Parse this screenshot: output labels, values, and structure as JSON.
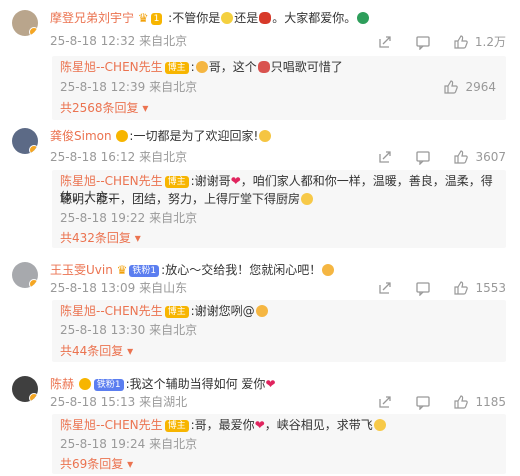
{
  "comments": [
    {
      "user": "摩登兄弟刘宇宁",
      "badge": "1",
      "text_a": ":不管你是",
      "text_b": "还是",
      "text_c": "。大家都爱你。",
      "time": "25-8-18 12:32",
      "loc": "来自北京",
      "likes": "1.2万",
      "reply": {
        "user": "陈星旭--CHEN先生",
        "badge": "博主",
        "text_a": ":",
        "text_b": "哥，这个",
        "text_c": "只唱歌可惜了",
        "time": "25-8-18 12:39",
        "loc": "来自北京",
        "likes": "2964"
      },
      "more": "共2568条回复"
    },
    {
      "user": "龚俊Simon",
      "text": ":一切都是为了欢迎回家!",
      "time": "25-8-18 16:12",
      "loc": "来自北京",
      "likes": "3607",
      "reply": {
        "user": "陈星旭--CHEN先生",
        "badge": "博主",
        "line1": ":谢谢哥",
        "line1b": "，咱们家人都和你一样，温暖，善良，温柔，得体，大方，",
        "line2": "聪明，能干，团结，努力，上得厅堂下得厨房",
        "time": "25-8-18 19:22",
        "loc": "来自北京"
      },
      "more": "共432条回复"
    },
    {
      "user": "王玉雯Uvin",
      "badge": "铁粉1",
      "text": ":放心～交给我！您就闲心吧！",
      "time": "25-8-18 13:09",
      "loc": "来自山东",
      "likes": "1553",
      "reply": {
        "user": "陈星旭--CHEN先生",
        "badge": "博主",
        "text": ":谢谢您咧@",
        "time": "25-8-18 13:30",
        "loc": "来自北京"
      },
      "more": "共44条回复"
    },
    {
      "user": "陈赫",
      "badge": "铁粉1",
      "text": ":我这个辅助当得如何 爱你",
      "time": "25-8-18 15:13",
      "loc": "来自湖北",
      "likes": "1185",
      "reply": {
        "user": "陈星旭--CHEN先生",
        "badge": "博主",
        "text_a": ":哥，最爱你",
        "text_b": "，峡谷相见，求带飞",
        "time": "25-8-18 19:24",
        "loc": "来自北京"
      },
      "more": "共69条回复"
    }
  ],
  "icons": {
    "share": "share-icon",
    "comment": "comment-icon",
    "like": "like-icon"
  },
  "colors": {
    "username": "#eb7350",
    "meta": "#999999",
    "reply_bg": "#f7f7f7",
    "badge": "#f7b500"
  }
}
